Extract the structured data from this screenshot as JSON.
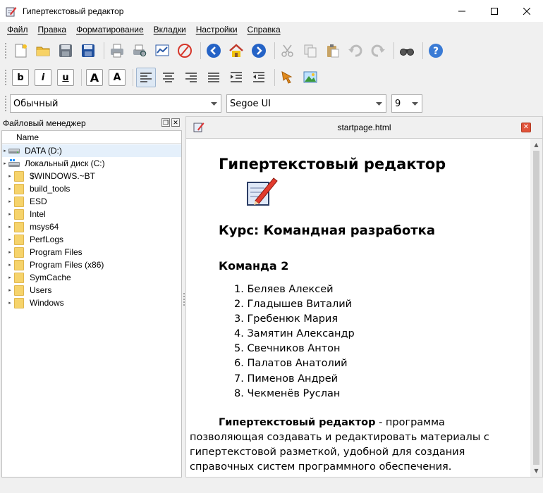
{
  "window": {
    "title": "Гипертекстовый редактор"
  },
  "menu": [
    "Файл",
    "Правка",
    "Форматирование",
    "Вкладки",
    "Настройки",
    "Справка"
  ],
  "toolbar_icons": [
    "new-document-icon",
    "open-folder-icon",
    "save-icon",
    "save-as-icon",
    "print-icon",
    "print-preview-icon",
    "chart-icon",
    "pdf-icon",
    "back-icon",
    "home-icon",
    "forward-icon",
    "cut-icon",
    "copy-icon",
    "paste-icon",
    "undo-icon",
    "redo-icon",
    "find-icon",
    "help-icon"
  ],
  "format_buttons": {
    "bold": "b",
    "italic": "i",
    "underline": "u",
    "font_larger": "A",
    "font_smaller": "A"
  },
  "style_combo": {
    "value": "Обычный"
  },
  "font_combo": {
    "value": "Segoe UI"
  },
  "size_combo": {
    "value": "9"
  },
  "file_manager": {
    "title": "Файловый менеджер",
    "column": "Name",
    "drives": [
      {
        "label": "DATA (D:)"
      },
      {
        "label": "Локальный диск (C:)"
      }
    ],
    "folders": [
      {
        "label": "$WINDOWS.~BT"
      },
      {
        "label": "build_tools"
      },
      {
        "label": "ESD"
      },
      {
        "label": "Intel"
      },
      {
        "label": "msys64"
      },
      {
        "label": "PerfLogs"
      },
      {
        "label": "Program Files"
      },
      {
        "label": "Program Files (x86)"
      },
      {
        "label": "SymCache"
      },
      {
        "label": "Users"
      },
      {
        "label": "Windows"
      }
    ]
  },
  "document": {
    "tab_title": "startpage.html",
    "heading": "Гипертекстовый редактор",
    "course": "Курс: Командная разработка",
    "team_title": "Команда 2",
    "members": [
      "1. Беляев Алексей",
      "2. Гладышев Виталий",
      "3. Гребенюк Мария",
      "4. Замятин Александр",
      "5. Свечников Антон",
      "6. Палатов Анатолий",
      "7. Пименов Андрей",
      "8. Чекменёв Руслан"
    ],
    "para_bold": "Гипертекстовый редактор",
    "para_text": " - программа позволяющая создавать и редактировать материалы с гипертекстовой разметкой, удобной для создания справочных систем программного обеспечения."
  }
}
